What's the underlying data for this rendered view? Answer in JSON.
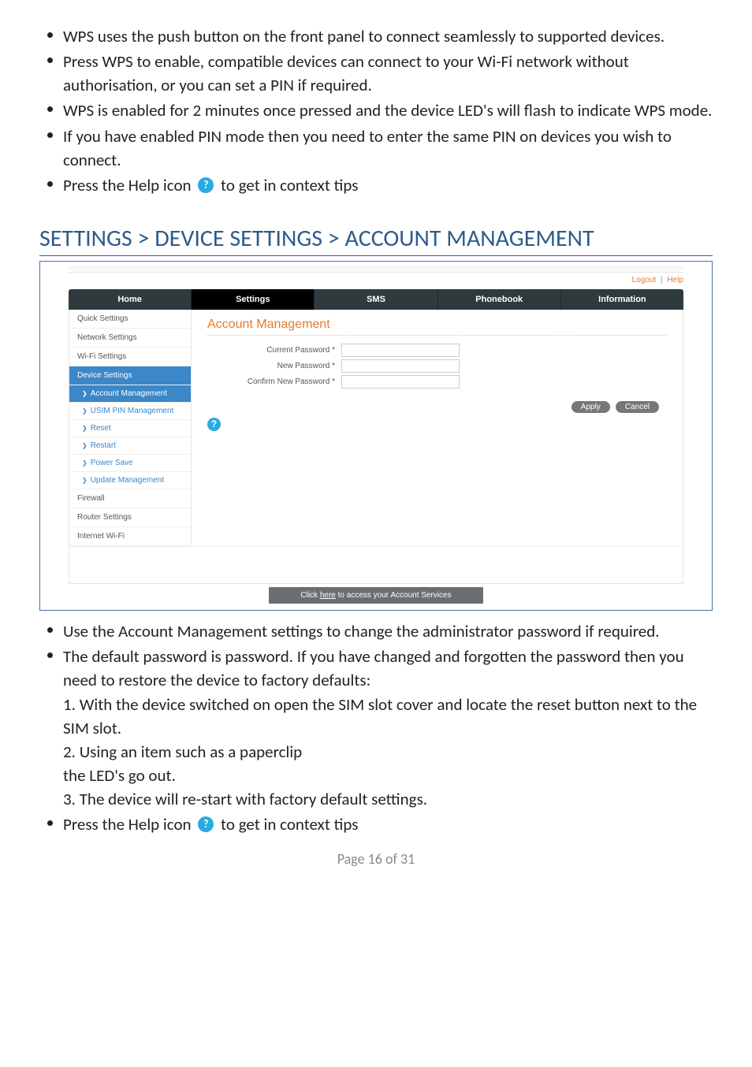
{
  "bullets_top": [
    "WPS uses the push button on the front panel to connect seamlessly to supported devices.",
    "Press WPS to enable, compatible devices can connect to your Wi-Fi network without authorisation, or you can set a PIN if required.",
    "WPS is enabled for 2 minutes once pressed and the device LED's will flash to indicate WPS mode.",
    "If you have enabled PIN mode then you need to enter the same PIN on devices you wish to connect."
  ],
  "help_bullet": {
    "pre": "Press the Help icon",
    "post": " to get in context tips"
  },
  "heading": "SETTINGS > DEVICE SETTINGS > ACCOUNT MANAGEMENT",
  "shot": {
    "util": {
      "logout": "Logout",
      "help": "Help"
    },
    "tabs": [
      "Home",
      "Settings",
      "SMS",
      "Phonebook",
      "Information"
    ],
    "active_tab": 1,
    "sidebar": {
      "top": [
        "Quick Settings",
        "Network Settings",
        "Wi-Fi Settings"
      ],
      "active_section": "Device Settings",
      "subs": [
        "Account Management",
        "USIM PIN Management",
        "Reset",
        "Restart",
        "Power Save",
        "Update Management"
      ],
      "active_sub": 0,
      "bottom": [
        "Firewall",
        "Router Settings",
        "Internet Wi-Fi"
      ]
    },
    "main": {
      "title": "Account Management",
      "fields": {
        "current": "Current Password *",
        "new": "New Password *",
        "confirm": "Confirm New Password *"
      },
      "buttons": {
        "apply": "Apply",
        "cancel": "Cancel"
      }
    },
    "footer": {
      "pre": "Click ",
      "link": "here",
      "post": " to access your Account Services"
    }
  },
  "bullets_bottom_1": "Use the Account Management settings to change the administrator password if required.",
  "bullets_bottom_2": "The default password is password. If you have changed and forgotten the password then you need to restore the device to factory defaults:",
  "steps": {
    "s1": "1. With the device switched on open the SIM slot cover and locate the reset button next to the SIM slot.",
    "s2a": "2. Using an item such as a paperclip",
    "s2b": "the LED's go out.",
    "s3": "3. The device will re-start with factory default settings."
  },
  "page_label": "Page 16 of 31",
  "help_glyph": "?"
}
